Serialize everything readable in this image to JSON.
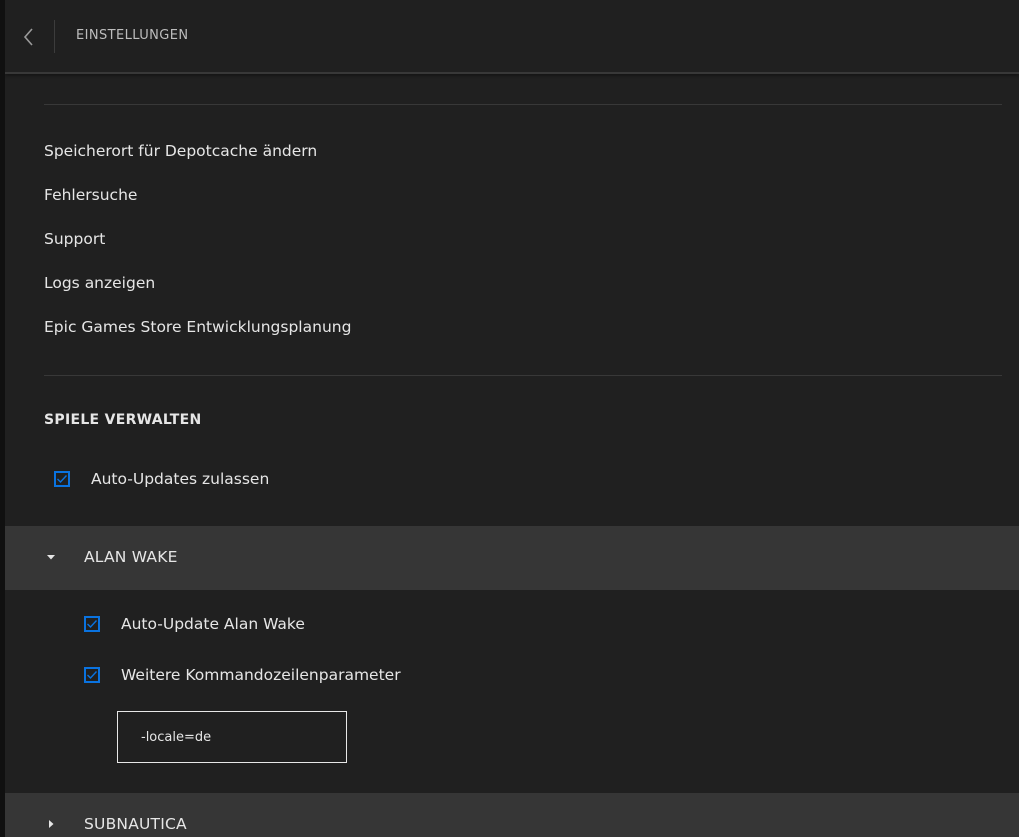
{
  "header": {
    "title": "EINSTELLUNGEN"
  },
  "links": [
    "Speicherort für Depotcache ändern",
    "Fehlersuche",
    "Support",
    "Logs anzeigen",
    "Epic Games Store Entwicklungsplanung"
  ],
  "manage_games": {
    "title": "SPIELE VERWALTEN",
    "auto_updates_label": "Auto-Updates zulassen",
    "auto_updates_checked": true
  },
  "games": [
    {
      "name": "ALAN WAKE",
      "expanded": true,
      "auto_update_label": "Auto-Update Alan Wake",
      "auto_update_checked": true,
      "cmd_params_label": "Weitere Kommandozeilenparameter",
      "cmd_params_checked": true,
      "cmd_params_value": "-locale=de"
    },
    {
      "name": "SUBNAUTICA",
      "expanded": false
    }
  ],
  "colors": {
    "accent": "#0a73e0",
    "background": "#202020",
    "game_bar": "#363636"
  }
}
